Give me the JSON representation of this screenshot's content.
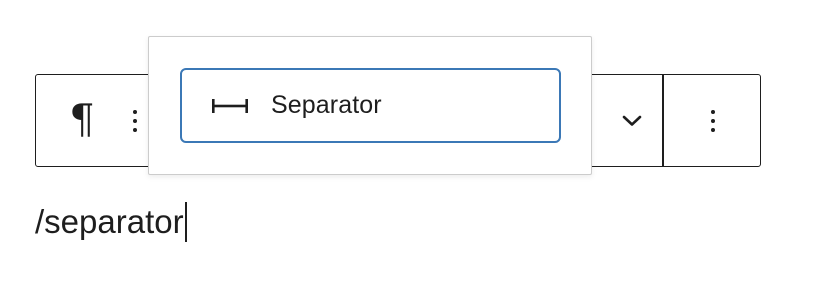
{
  "toolbar": {
    "block_type_symbol": "¶",
    "block_type_icon": "paragraph-icon",
    "drag_icon": "drag-handle-icon",
    "chevron_icon": "chevron-down-icon",
    "options_icon": "more-vertical-icon"
  },
  "inserter": {
    "items": [
      {
        "label": "Separator",
        "icon": "separator-icon"
      }
    ]
  },
  "editor": {
    "text": "/separator"
  },
  "colors": {
    "text": "#1e1e1e",
    "selection_border": "#3b78b6",
    "popover_border": "#cccccc"
  }
}
